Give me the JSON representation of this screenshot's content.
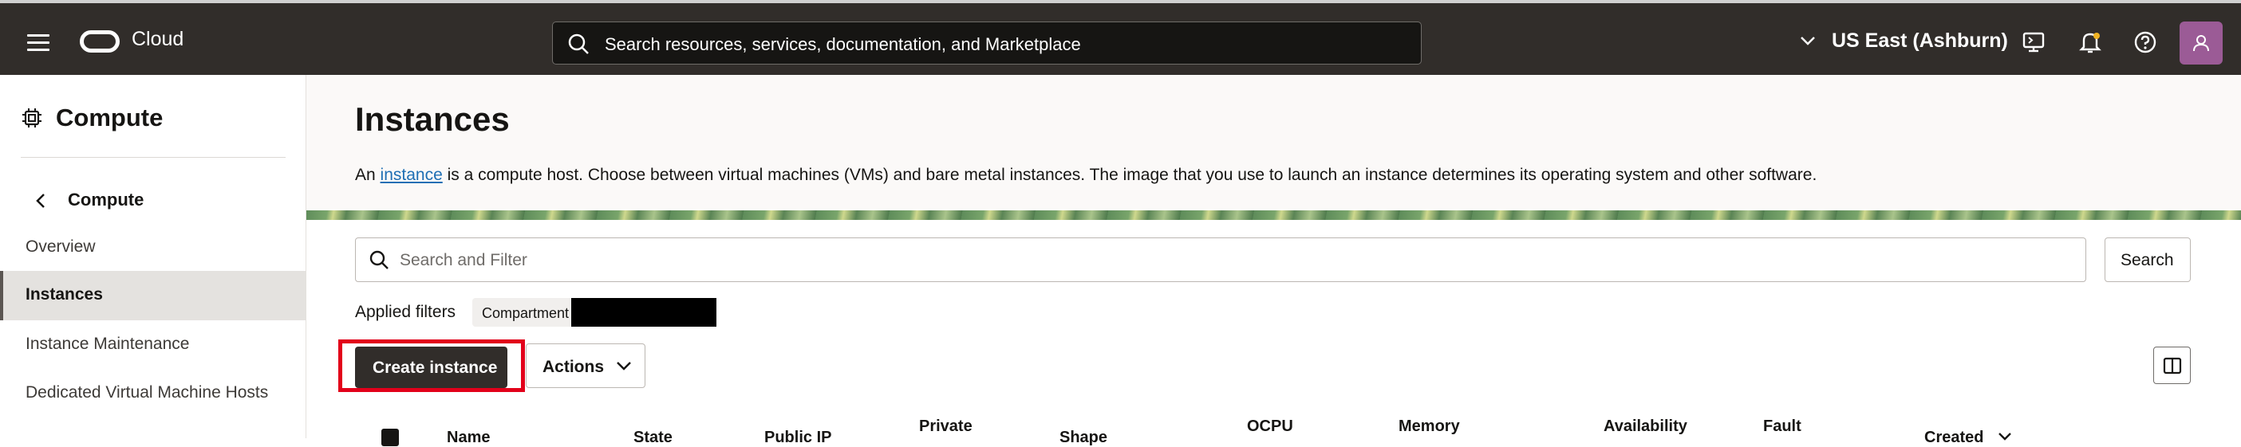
{
  "header": {
    "brand": "Cloud",
    "search_placeholder": "Search resources, services, documentation, and Marketplace",
    "region": "US East (Ashburn)",
    "colors": {
      "bar": "#312d2a",
      "avatar": "#9b5b96"
    },
    "icons": [
      "menu-icon",
      "oracle-logo-icon",
      "search-icon",
      "chevron-down-icon",
      "cloud-shell-icon",
      "bell-icon",
      "help-icon",
      "user-icon"
    ]
  },
  "sidebar": {
    "title": "Compute",
    "back_label": "Compute",
    "items": [
      {
        "label": "Overview",
        "active": false
      },
      {
        "label": "Instances",
        "active": true
      },
      {
        "label": "Instance Maintenance",
        "active": false
      },
      {
        "label": "Dedicated Virtual Machine Hosts",
        "active": false
      }
    ]
  },
  "main": {
    "title": "Instances",
    "description_prefix": "An ",
    "description_link": "instance",
    "description_suffix": " is a compute host. Choose between virtual machines (VMs) and bare metal instances. The image that you use to launch an instance determines its operating system and other software.",
    "filter_placeholder": "Search and Filter",
    "search_button": "Search",
    "applied_filters_label": "Applied filters",
    "chip_label": "Compartment",
    "create_button": "Create instance",
    "actions_button": "Actions",
    "highlight_color": "#e2001a"
  },
  "table": {
    "headers": [
      "Name",
      "State",
      "Public IP",
      "Private",
      "Shape",
      "OCPU",
      "Memory",
      "Availability",
      "Fault",
      "Created"
    ]
  }
}
